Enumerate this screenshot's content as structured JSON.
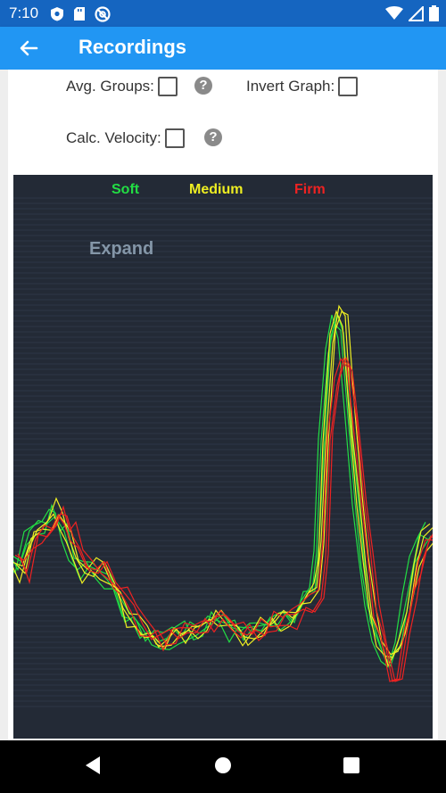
{
  "status_bar": {
    "time": "7:10",
    "icons": [
      "shield-icon",
      "sd-card-icon",
      "at-sign-icon",
      "wifi-icon",
      "cell-signal-icon",
      "battery-icon"
    ]
  },
  "app_bar": {
    "title": "Recordings",
    "back_icon": "arrow-left-icon"
  },
  "options": {
    "avg_groups_label": "Avg. Groups:",
    "invert_graph_label": "Invert Graph:",
    "calc_velocity_label": "Calc. Velocity:",
    "avg_groups_checked": false,
    "invert_graph_checked": false,
    "calc_velocity_checked": false,
    "help_symbol": "?"
  },
  "graph": {
    "expand_label": "Expand",
    "background": "#232a36",
    "legend": [
      {
        "label": "Soft",
        "color": "#22dd44"
      },
      {
        "label": "Medium",
        "color": "#eeee22"
      },
      {
        "label": "Firm",
        "color": "#ee2222"
      }
    ]
  },
  "nav_bar": {
    "icons": [
      "back-triangle-icon",
      "home-circle-icon",
      "recents-square-icon"
    ]
  }
}
